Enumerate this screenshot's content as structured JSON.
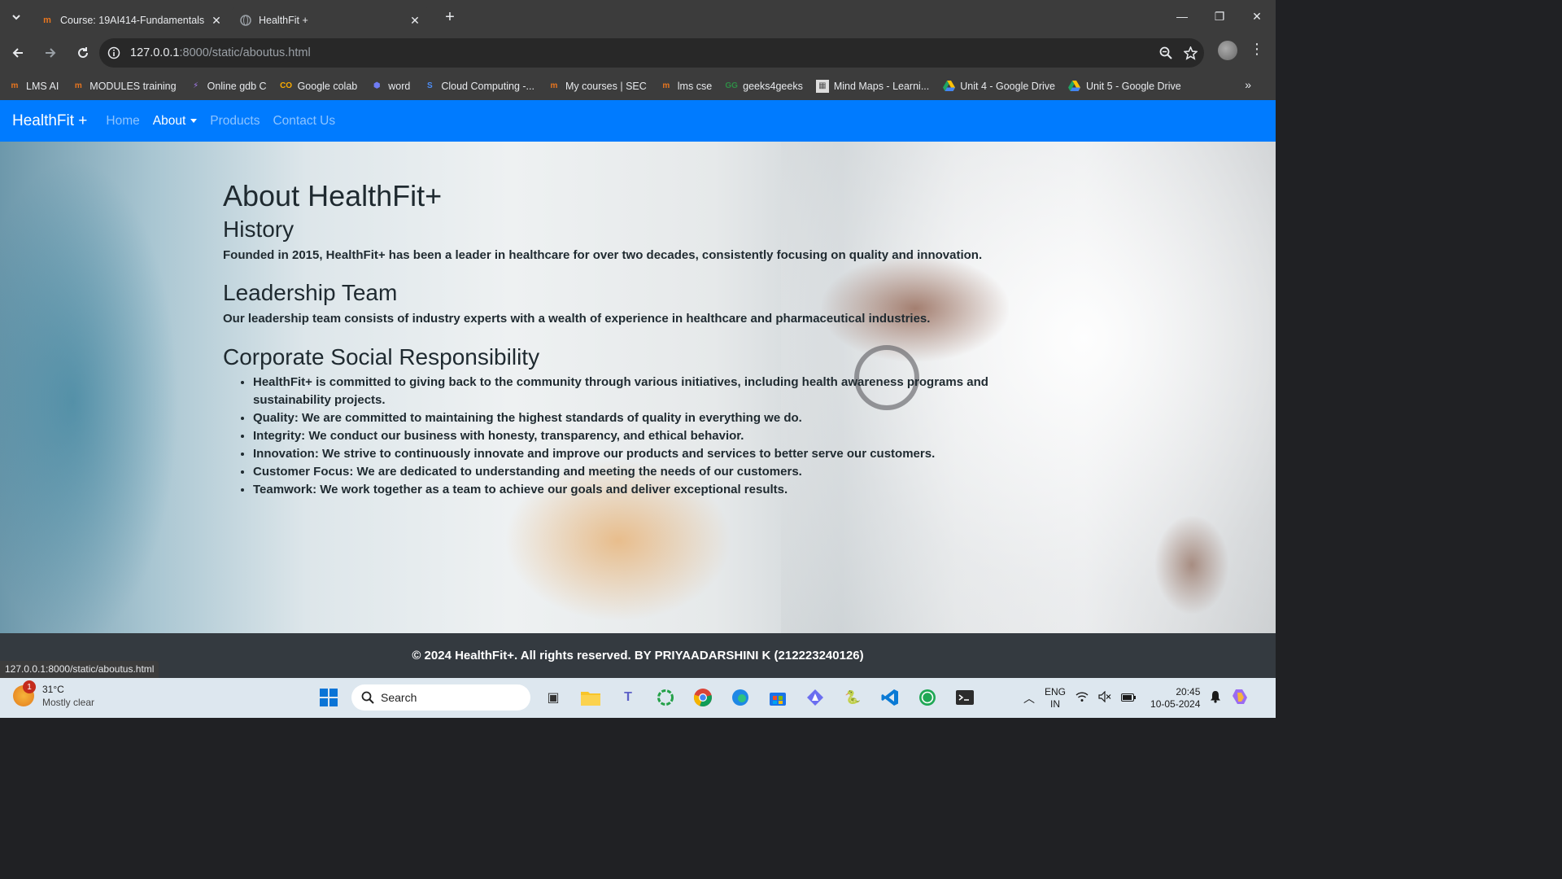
{
  "browser": {
    "tabs": [
      {
        "title": "Course: 19AI414-Fundamentals",
        "favicon": "moodle-icon",
        "active": false
      },
      {
        "title": "HealthFit +",
        "favicon": "globe-icon",
        "active": true
      }
    ],
    "address": {
      "host": "127.0.0.1",
      "rest": ":8000/static/aboutus.html"
    },
    "bookmarks": [
      {
        "label": "LMS AI",
        "icon": "moodle-icon"
      },
      {
        "label": "MODULES training",
        "icon": "moodle-icon"
      },
      {
        "label": "Online gdb C",
        "icon": "gdb-icon"
      },
      {
        "label": "Google colab",
        "icon": "colab-icon"
      },
      {
        "label": "word",
        "icon": "word-icon"
      },
      {
        "label": "Cloud Computing -...",
        "icon": "cloud-icon"
      },
      {
        "label": "My courses | SEC",
        "icon": "moodle-icon"
      },
      {
        "label": "lms cse",
        "icon": "moodle-icon"
      },
      {
        "label": "geeks4geeks",
        "icon": "gfg-icon"
      },
      {
        "label": "Mind Maps - Learni...",
        "icon": "mindmap-icon"
      },
      {
        "label": "Unit 4 - Google Drive",
        "icon": "drive-icon"
      },
      {
        "label": "Unit 5 - Google Drive",
        "icon": "drive-icon"
      }
    ],
    "status_url": "127.0.0.1:8000/static/aboutus.html"
  },
  "site": {
    "brand": "HealthFit +",
    "nav": {
      "home": "Home",
      "about": "About",
      "products": "Products",
      "contact": "Contact Us"
    },
    "title": "About HealthFit+",
    "history_heading": "History",
    "history_text": "Founded in 2015, HealthFit+ has been a leader in healthcare for over two decades, consistently focusing on quality and innovation.",
    "leadership_heading": "Leadership Team",
    "leadership_text": "Our leadership team consists of industry experts with a wealth of experience in healthcare and pharmaceutical industries.",
    "csr_heading": "Corporate Social Responsibility",
    "csr_items": [
      "HealthFit+ is committed to giving back to the community through various initiatives, including health awareness programs and sustainability projects.",
      "Quality: We are committed to maintaining the highest standards of quality in everything we do.",
      "Integrity: We conduct our business with honesty, transparency, and ethical behavior.",
      "Innovation: We strive to continuously innovate and improve our products and services to better serve our customers.",
      "Customer Focus: We are dedicated to understanding and meeting the needs of our customers.",
      "Teamwork: We work together as a team to achieve our goals and deliver exceptional results."
    ],
    "footer": "© 2024 HealthFit+. All rights reserved. BY PRIYAADARSHINI K (212223240126)",
    "colors": {
      "navbar": "#007bff",
      "footer": "#343a40"
    }
  },
  "taskbar": {
    "weather_temp": "31°C",
    "weather_desc": "Mostly clear",
    "weather_badge": "1",
    "search_label": "Search",
    "lang_top": "ENG",
    "lang_bottom": "IN",
    "time": "20:45",
    "date": "10-05-2024"
  }
}
